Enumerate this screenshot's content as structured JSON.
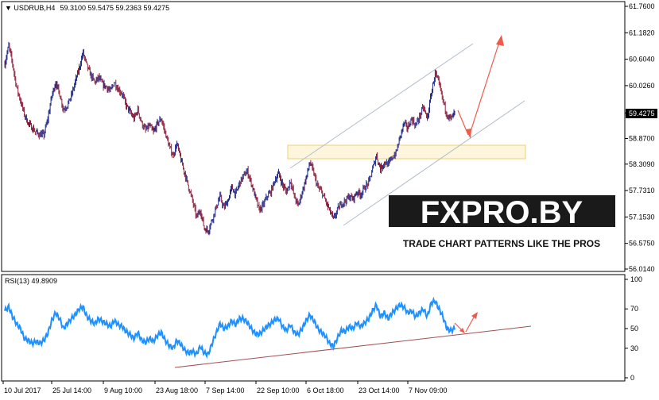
{
  "header": {
    "symbol": "USDRUB,H4",
    "ohlc": "59.3100 59.5475 59.2363 59.4275"
  },
  "rsi_header": "RSI(13) 49.8909",
  "logo": {
    "brand": "FXPRO.BY",
    "tagline": "TRADE CHART PATTERNS LIKE THE PROS"
  },
  "colors": {
    "bull": "#1f2a8c",
    "bear": "#8c1f3c",
    "rsi": "#1e90ff",
    "channel": "#b0bcc8",
    "arrow": "#f05a4a",
    "zone": "#f0d070",
    "trendline": "#a05050"
  },
  "chart_data": [
    {
      "type": "candlestick",
      "symbol": "USDRUB",
      "timeframe": "H4",
      "last_price": "59.4275",
      "ylim": [
        56.014,
        61.76
      ],
      "y_ticks": [
        "61.7600",
        "61.1820",
        "60.6040",
        "60.0260",
        "59.4275",
        "58.8700",
        "58.3090",
        "57.7310",
        "57.1530",
        "56.5750",
        "56.0140"
      ],
      "x_ticks": [
        "10 Jul 2017",
        "25 Jul 14:00",
        "9 Aug 10:00",
        "23 Aug 18:00",
        "7 Sep 14:00",
        "22 Sep 10:00",
        "6 Oct 18:00",
        "23 Oct 14:00",
        "7 Nov 09:00"
      ],
      "close_path": [
        [
          0,
          60.5
        ],
        [
          5,
          60.9
        ],
        [
          10,
          60.5
        ],
        [
          15,
          60.0
        ],
        [
          20,
          59.7
        ],
        [
          25,
          59.4
        ],
        [
          30,
          59.2
        ],
        [
          35,
          59.1
        ],
        [
          40,
          59.0
        ],
        [
          45,
          58.95
        ],
        [
          50,
          58.95
        ],
        [
          55,
          59.3
        ],
        [
          60,
          59.8
        ],
        [
          65,
          60.1
        ],
        [
          70,
          59.85
        ],
        [
          75,
          59.5
        ],
        [
          80,
          59.6
        ],
        [
          85,
          59.8
        ],
        [
          90,
          60.1
        ],
        [
          95,
          60.4
        ],
        [
          100,
          60.75
        ],
        [
          105,
          60.45
        ],
        [
          110,
          60.25
        ],
        [
          115,
          60.1
        ],
        [
          120,
          60.2
        ],
        [
          125,
          60.05
        ],
        [
          130,
          60.0
        ],
        [
          135,
          59.9
        ],
        [
          140,
          60.1
        ],
        [
          145,
          59.95
        ],
        [
          150,
          59.85
        ],
        [
          155,
          59.6
        ],
        [
          160,
          59.45
        ],
        [
          165,
          59.3
        ],
        [
          170,
          59.5
        ],
        [
          175,
          59.2
        ],
        [
          180,
          59.05
        ],
        [
          185,
          59.15
        ],
        [
          190,
          59.0
        ],
        [
          195,
          59.2
        ],
        [
          200,
          59.3
        ],
        [
          205,
          59.0
        ],
        [
          210,
          58.7
        ],
        [
          215,
          58.5
        ],
        [
          220,
          58.75
        ],
        [
          225,
          58.4
        ],
        [
          230,
          58.1
        ],
        [
          235,
          57.8
        ],
        [
          240,
          57.5
        ],
        [
          245,
          57.15
        ],
        [
          250,
          57.3
        ],
        [
          255,
          56.9
        ],
        [
          260,
          56.85
        ],
        [
          265,
          57.1
        ],
        [
          270,
          57.35
        ],
        [
          275,
          57.6
        ],
        [
          280,
          57.35
        ],
        [
          285,
          57.5
        ],
        [
          290,
          57.8
        ],
        [
          295,
          57.65
        ],
        [
          300,
          57.9
        ],
        [
          305,
          58.05
        ],
        [
          310,
          58.15
        ],
        [
          315,
          57.9
        ],
        [
          320,
          57.6
        ],
        [
          325,
          57.3
        ],
        [
          330,
          57.4
        ],
        [
          335,
          57.6
        ],
        [
          340,
          57.7
        ],
        [
          345,
          57.95
        ],
        [
          350,
          58.1
        ],
        [
          355,
          57.85
        ],
        [
          360,
          57.7
        ],
        [
          365,
          57.95
        ],
        [
          370,
          57.6
        ],
        [
          375,
          57.4
        ],
        [
          380,
          57.7
        ],
        [
          385,
          58.0
        ],
        [
          390,
          58.35
        ],
        [
          395,
          58.1
        ],
        [
          400,
          57.8
        ],
        [
          405,
          57.7
        ],
        [
          410,
          57.5
        ],
        [
          415,
          57.3
        ],
        [
          420,
          57.1
        ],
        [
          425,
          57.3
        ],
        [
          430,
          57.45
        ],
        [
          435,
          57.5
        ],
        [
          440,
          57.6
        ],
        [
          445,
          57.55
        ],
        [
          450,
          57.7
        ],
        [
          455,
          57.65
        ],
        [
          460,
          57.8
        ],
        [
          465,
          57.9
        ],
        [
          470,
          58.2
        ],
        [
          475,
          58.5
        ],
        [
          480,
          58.2
        ],
        [
          485,
          58.35
        ],
        [
          490,
          58.3
        ],
        [
          495,
          58.45
        ],
        [
          500,
          58.55
        ],
        [
          505,
          58.9
        ],
        [
          510,
          59.2
        ],
        [
          515,
          59.1
        ],
        [
          520,
          59.3
        ],
        [
          525,
          59.15
        ],
        [
          530,
          59.35
        ],
        [
          535,
          59.55
        ],
        [
          540,
          59.3
        ],
        [
          545,
          59.85
        ],
        [
          550,
          60.3
        ],
        [
          555,
          60.05
        ],
        [
          560,
          59.7
        ],
        [
          565,
          59.4
        ],
        [
          570,
          59.3
        ],
        [
          575,
          59.43
        ]
      ]
    },
    {
      "type": "line",
      "name": "RSI(13)",
      "last_value": 49.8909,
      "ylim": [
        0,
        100
      ],
      "y_ticks": [
        100,
        70,
        50,
        30,
        0
      ],
      "points": [
        [
          0,
          68
        ],
        [
          5,
          72
        ],
        [
          10,
          62
        ],
        [
          15,
          55
        ],
        [
          20,
          50
        ],
        [
          25,
          40
        ],
        [
          30,
          38
        ],
        [
          35,
          35
        ],
        [
          40,
          37
        ],
        [
          45,
          35
        ],
        [
          50,
          38
        ],
        [
          55,
          45
        ],
        [
          60,
          58
        ],
        [
          65,
          66
        ],
        [
          70,
          60
        ],
        [
          75,
          50
        ],
        [
          80,
          55
        ],
        [
          85,
          60
        ],
        [
          90,
          64
        ],
        [
          95,
          70
        ],
        [
          100,
          72
        ],
        [
          105,
          62
        ],
        [
          110,
          58
        ],
        [
          115,
          55
        ],
        [
          120,
          60
        ],
        [
          125,
          57
        ],
        [
          130,
          55
        ],
        [
          135,
          52
        ],
        [
          140,
          58
        ],
        [
          145,
          54
        ],
        [
          150,
          52
        ],
        [
          155,
          47
        ],
        [
          160,
          44
        ],
        [
          165,
          40
        ],
        [
          170,
          46
        ],
        [
          175,
          38
        ],
        [
          180,
          36
        ],
        [
          185,
          40
        ],
        [
          190,
          37
        ],
        [
          195,
          43
        ],
        [
          200,
          46
        ],
        [
          205,
          38
        ],
        [
          210,
          33
        ],
        [
          215,
          30
        ],
        [
          220,
          38
        ],
        [
          225,
          34
        ],
        [
          230,
          28
        ],
        [
          235,
          25
        ],
        [
          240,
          27
        ],
        [
          245,
          24
        ],
        [
          250,
          32
        ],
        [
          255,
          25
        ],
        [
          260,
          24
        ],
        [
          265,
          35
        ],
        [
          270,
          45
        ],
        [
          275,
          55
        ],
        [
          280,
          50
        ],
        [
          285,
          52
        ],
        [
          290,
          58
        ],
        [
          295,
          54
        ],
        [
          300,
          60
        ],
        [
          305,
          60
        ],
        [
          310,
          56
        ],
        [
          315,
          50
        ],
        [
          320,
          45
        ],
        [
          325,
          44
        ],
        [
          330,
          48
        ],
        [
          335,
          52
        ],
        [
          340,
          55
        ],
        [
          345,
          59
        ],
        [
          350,
          60
        ],
        [
          355,
          52
        ],
        [
          360,
          48
        ],
        [
          365,
          54
        ],
        [
          370,
          46
        ],
        [
          375,
          44
        ],
        [
          380,
          50
        ],
        [
          385,
          58
        ],
        [
          390,
          64
        ],
        [
          395,
          58
        ],
        [
          400,
          50
        ],
        [
          405,
          46
        ],
        [
          410,
          42
        ],
        [
          415,
          35
        ],
        [
          420,
          32
        ],
        [
          425,
          40
        ],
        [
          430,
          48
        ],
        [
          435,
          47
        ],
        [
          440,
          52
        ],
        [
          445,
          50
        ],
        [
          450,
          56
        ],
        [
          455,
          52
        ],
        [
          460,
          56
        ],
        [
          465,
          60
        ],
        [
          470,
          68
        ],
        [
          475,
          74
        ],
        [
          480,
          62
        ],
        [
          485,
          66
        ],
        [
          490,
          60
        ],
        [
          495,
          66
        ],
        [
          500,
          70
        ],
        [
          505,
          74
        ],
        [
          510,
          72
        ],
        [
          515,
          66
        ],
        [
          520,
          68
        ],
        [
          525,
          62
        ],
        [
          530,
          66
        ],
        [
          535,
          70
        ],
        [
          540,
          62
        ],
        [
          545,
          76
        ],
        [
          550,
          78
        ],
        [
          555,
          70
        ],
        [
          560,
          62
        ],
        [
          565,
          50
        ],
        [
          570,
          48
        ],
        [
          575,
          50
        ]
      ]
    }
  ]
}
